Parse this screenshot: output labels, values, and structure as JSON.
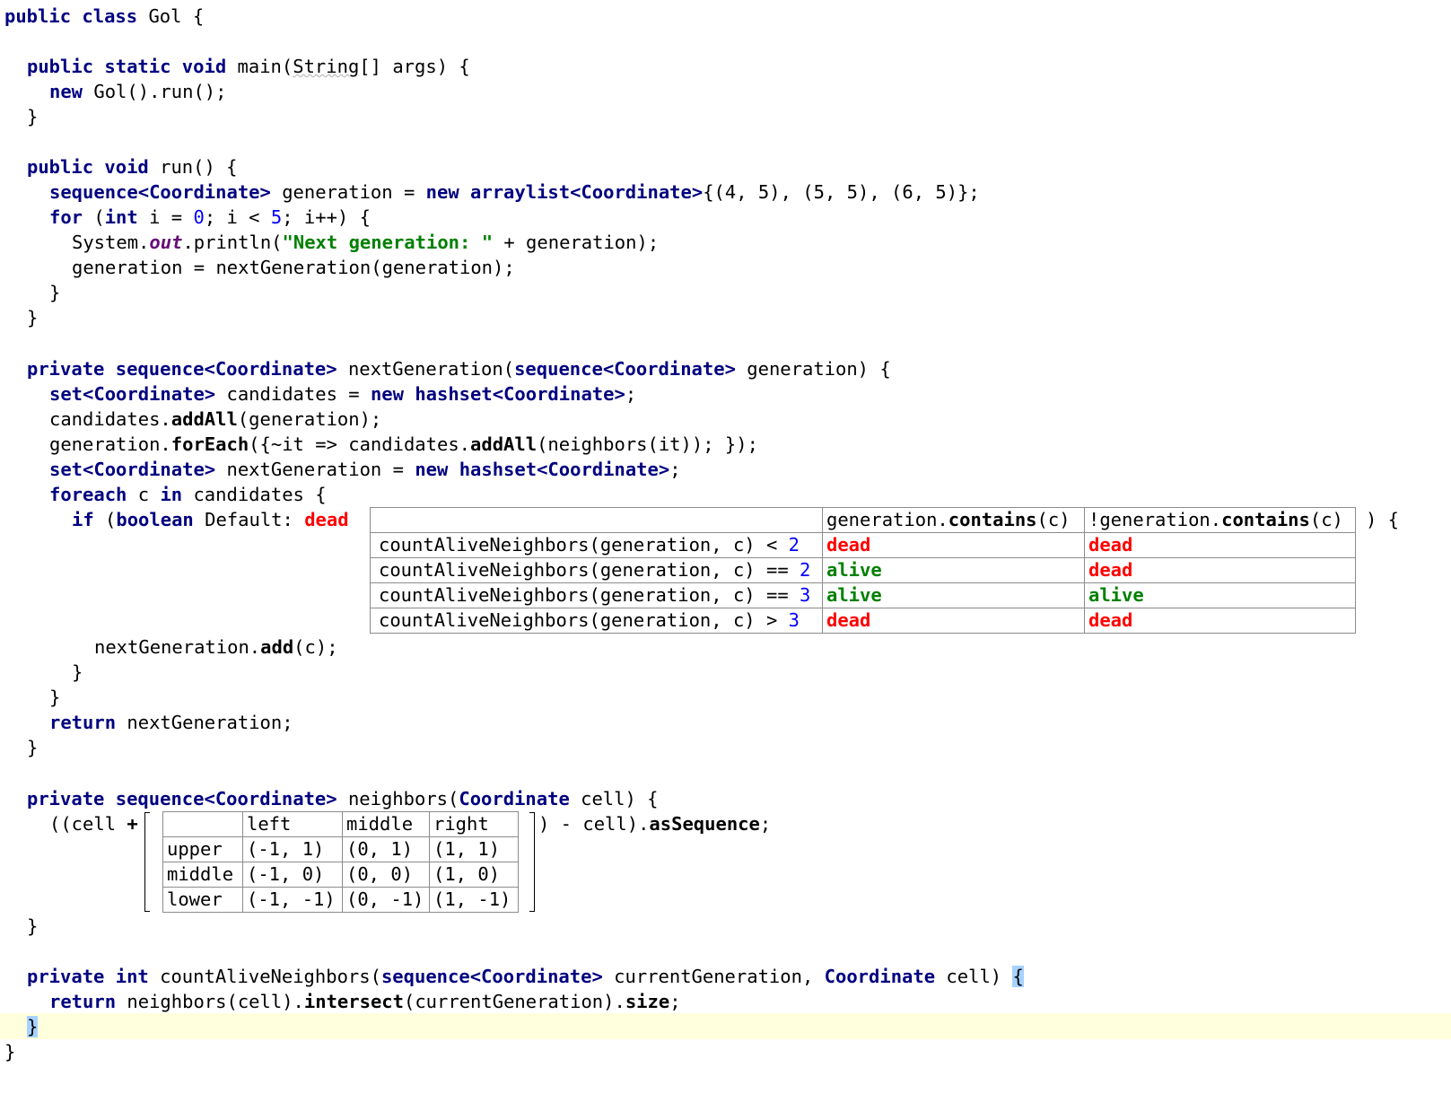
{
  "editor": {
    "class_decl": {
      "kw": "public class",
      "name": "Gol",
      "open": "{"
    },
    "main": {
      "kw": "public static void",
      "sig_a": "main(",
      "type": "String",
      "sig_b": "[] args) {",
      "body_kw": "new",
      "body": "Gol().run();",
      "close": "}"
    },
    "run": {
      "kw": "public void",
      "sig": "run() {",
      "l1_type": "sequence<Coordinate>",
      "l1_a": "generation =",
      "l1_new": "new",
      "l1_type2": "arraylist<Coordinate>",
      "l1_b": "{(4, 5), (5, 5), (6, 5)};",
      "l2_kw": "for",
      "l2_a": "(",
      "l2_int": "int",
      "l2_b": "i =",
      "l2_zero": "0",
      "l2_c": "; i <",
      "l2_five": "5",
      "l2_d": "; i++) {",
      "l3_a": "System.",
      "l3_field": "out",
      "l3_b": ".println(",
      "l3_str": "\"Next generation: \"",
      "l3_c": " + generation);",
      "l4": "generation = nextGeneration(generation);",
      "close_inner": "}",
      "close": "}"
    },
    "next_generation": {
      "kw": "private",
      "type": "sequence<Coordinate>",
      "sig_a": "nextGeneration(",
      "ptype": "sequence<Coordinate>",
      "sig_b": "generation) {",
      "l1_type": "set<Coordinate>",
      "l1_a": "candidates =",
      "l1_new": "new",
      "l1_type2": "hashset<Coordinate>",
      "l1_b": ";",
      "l2_a": "candidates.",
      "l2_m": "addAll",
      "l2_b": "(generation);",
      "l3_a": "generation.",
      "l3_m": "forEach",
      "l3_b": "({~it => candidates.",
      "l3_m2": "addAll",
      "l3_c": "(neighbors(it)); });",
      "l4_type": "set<Coordinate>",
      "l4_a": "nextGeneration =",
      "l4_new": "new",
      "l4_type2": "hashset<Coordinate>",
      "l4_b": ";",
      "l5_kw": "foreach",
      "l5_a": "c",
      "l5_in": "in",
      "l5_b": "candidates {",
      "l6_kw": "if",
      "l6_a": "(",
      "l6_bool": "boolean",
      "l6_b": "Default:",
      "l6_default": "dead",
      "l6_close": ") {",
      "l7_a": "nextGeneration.",
      "l7_m": "add",
      "l7_b": "(c);",
      "close1": "}",
      "close2": "}",
      "ret_kw": "return",
      "ret": "nextGeneration;",
      "close": "}"
    },
    "decision_table": {
      "col_headers": [
        {
          "a": "generation.",
          "m": "contains",
          "b": "(c)"
        },
        {
          "a": "!generation.",
          "m": "contains",
          "b": "(c)"
        }
      ],
      "rows": [
        {
          "cond": "countAliveNeighbors(generation, c) <",
          "n": "2",
          "v": [
            "dead",
            "dead"
          ]
        },
        {
          "cond": "countAliveNeighbors(generation, c) ==",
          "n": "2",
          "v": [
            "alive",
            "dead"
          ]
        },
        {
          "cond": "countAliveNeighbors(generation, c) ==",
          "n": "3",
          "v": [
            "alive",
            "alive"
          ]
        },
        {
          "cond": "countAliveNeighbors(generation, c) >",
          "n": "3",
          "v": [
            "dead",
            "dead"
          ]
        }
      ]
    },
    "neighbors": {
      "kw": "private",
      "type": "sequence<Coordinate>",
      "sig_a": "neighbors(",
      "ptype": "Coordinate",
      "sig_b": "cell) {",
      "expr_a": "((cell",
      "plus": "+",
      "expr_b": ") - cell).",
      "expr_m": "asSequence",
      "expr_c": ";",
      "close": "}"
    },
    "neighbor_table": {
      "col_headers": [
        "",
        "left",
        "middle",
        "right"
      ],
      "rows": [
        [
          "upper",
          "(-1, 1)",
          "(0, 1)",
          "(1, 1)"
        ],
        [
          "middle",
          "(-1, 0)",
          "(0, 0)",
          "(1, 0)"
        ],
        [
          "lower",
          "(-1, -1)",
          "(0, -1)",
          "(1, -1)"
        ]
      ]
    },
    "count": {
      "kw": "private int",
      "sig_a": "countAliveNeighbors(",
      "ptype": "sequence<Coordinate>",
      "sig_b": "currentGeneration,",
      "ptype2": "Coordinate",
      "sig_c": "cell)",
      "open": "{",
      "ret_kw": "return",
      "ret_a": "neighbors(cell).",
      "ret_m": "intersect",
      "ret_b": "(currentGeneration).",
      "ret_m2": "size",
      "ret_c": ";",
      "close": "}"
    },
    "class_close": "}"
  }
}
